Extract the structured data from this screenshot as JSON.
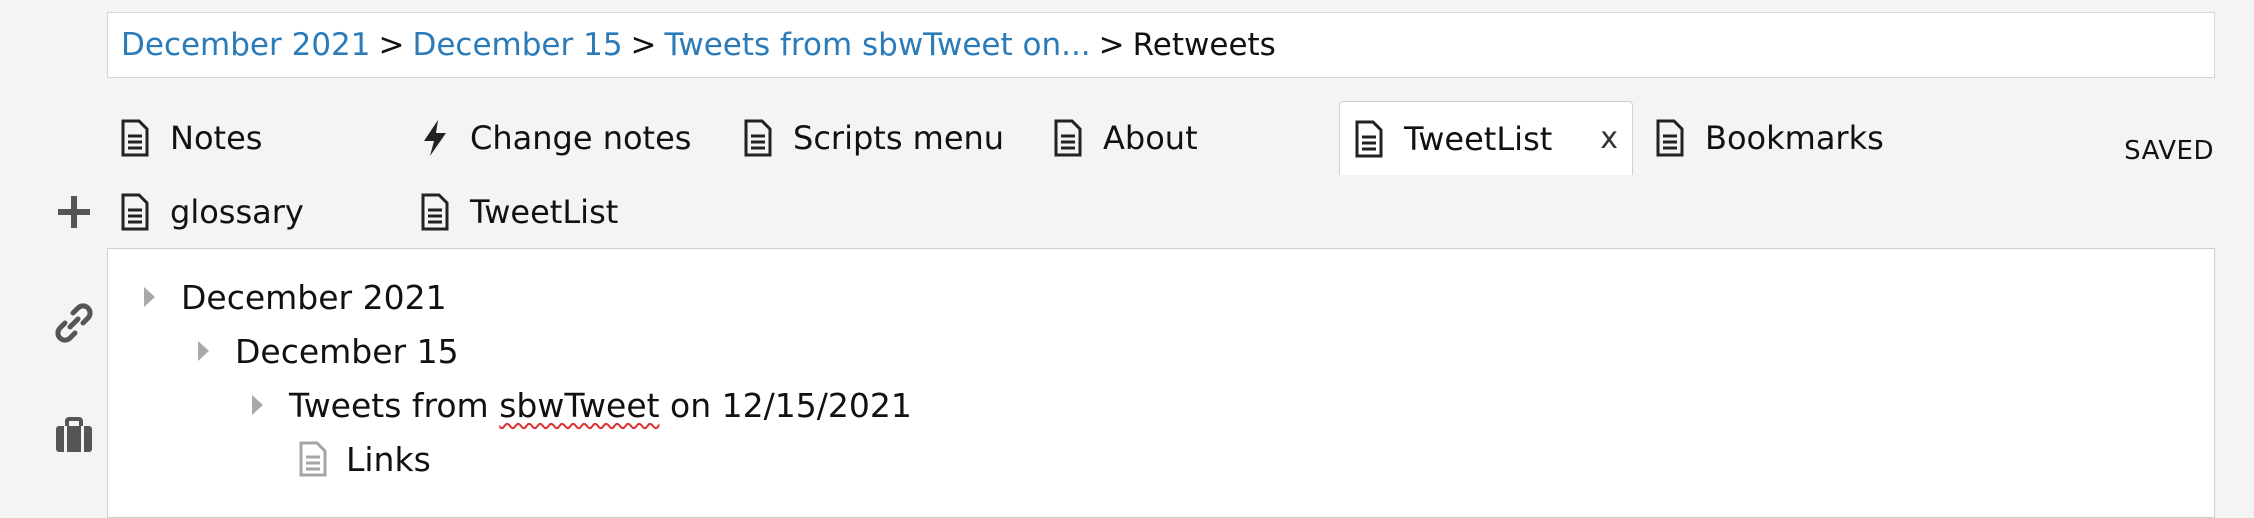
{
  "breadcrumb": {
    "items": [
      "December 2021",
      "December 15",
      "Tweets from sbwTweet on..."
    ],
    "current": "Retweets",
    "separator": ">"
  },
  "tabs": {
    "row1": [
      {
        "label": "Notes",
        "icon": "document-icon"
      },
      {
        "label": "Change notes",
        "icon": "lightning-icon"
      },
      {
        "label": "Scripts menu",
        "icon": "document-icon"
      },
      {
        "label": "About",
        "icon": "document-icon"
      },
      {
        "label": "TweetList",
        "icon": "document-icon",
        "active": true,
        "close": "x"
      },
      {
        "label": "Bookmarks",
        "icon": "document-icon"
      }
    ],
    "row2": [
      {
        "label": "glossary",
        "icon": "document-icon"
      },
      {
        "label": "TweetList",
        "icon": "document-icon"
      }
    ]
  },
  "status": {
    "saved": "SAVED"
  },
  "rail": {
    "icons": [
      "plus-icon",
      "link-icon",
      "briefcase-icon"
    ]
  },
  "tree": {
    "nodes": [
      {
        "label": "December 2021",
        "level": 0,
        "icon": "caret-right-icon"
      },
      {
        "label": "December 15",
        "level": 1,
        "icon": "caret-right-icon"
      },
      {
        "label_prefix": "Tweets from ",
        "label_misspelled": "sbwTweet",
        "label_suffix": " on 12/15/2021",
        "level": 2,
        "icon": "caret-right-icon"
      },
      {
        "label": "Links",
        "level": 3,
        "icon": "page-icon"
      }
    ]
  },
  "colors": {
    "link": "#2b7bb9",
    "background": "#f4f4f4",
    "panel": "#ffffff",
    "spellcheck": "#dd3333"
  }
}
